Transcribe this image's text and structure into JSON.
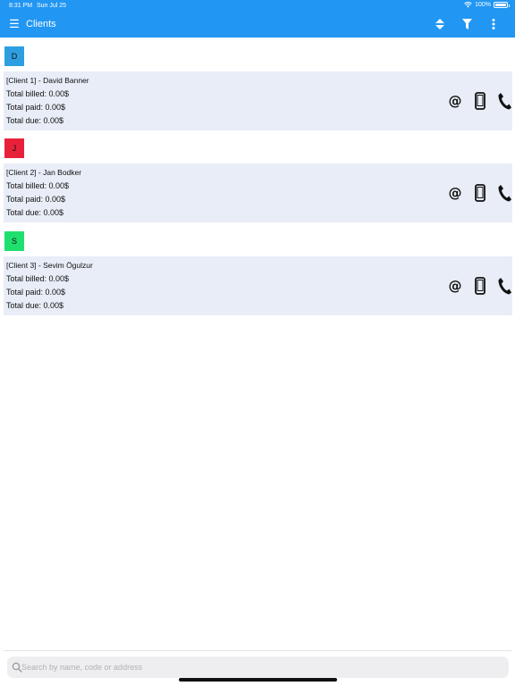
{
  "status_bar": {
    "time": "8:31 PM",
    "date": "Sun Jul 25",
    "battery": "100%"
  },
  "app_bar": {
    "title": "Clients",
    "color": "#2196f3",
    "icons": [
      "menu-icon",
      "sort-icon",
      "filter-icon",
      "more-vert-icon"
    ]
  },
  "groups": [
    {
      "letter": "D",
      "color": "#2d9fe0"
    },
    {
      "letter": "J",
      "color": "#e8213a"
    },
    {
      "letter": "S",
      "color": "#1fe06e"
    }
  ],
  "clients": [
    {
      "header": "[Client 1] - David Banner",
      "total_billed": "Total billed: 0.00$",
      "total_paid": "Total paid: 0.00$",
      "total_due": "Total due: 0.00$",
      "email_icon": "@"
    },
    {
      "header": "[Client 2] - Jan Bodker",
      "total_billed": "Total billed: 0.00$",
      "total_paid": "Total paid: 0.00$",
      "total_due": "Total due: 0.00$",
      "email_icon": "@"
    },
    {
      "header": "[Client 3] - Sevim Ögulzur",
      "total_billed": "Total billed: 0.00$",
      "total_paid": "Total paid: 0.00$",
      "total_due": "Total due: 0.00$",
      "email_icon": "@"
    }
  ],
  "search": {
    "placeholder": "Search by name, code or address",
    "value": ""
  },
  "menu_icon_glyph": "☰"
}
